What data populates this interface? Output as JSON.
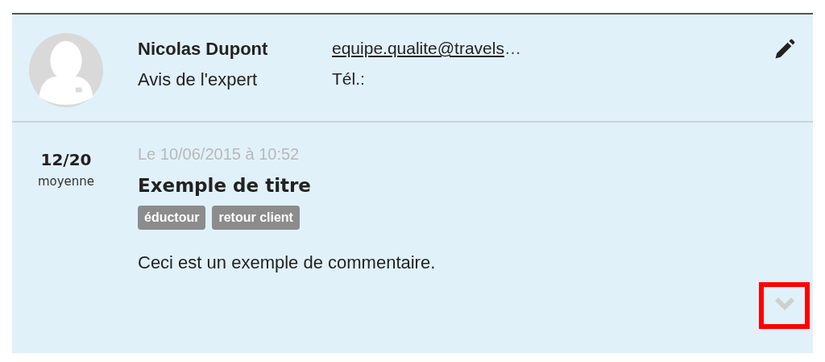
{
  "expert": {
    "name": "Nicolas Dupont",
    "role": "Avis de l'expert",
    "email": "equipe.qualite@travels",
    "email_truncation": "…",
    "phone_label": "Tél.:"
  },
  "review": {
    "score": "12/20",
    "score_label": "moyenne",
    "date": "Le 10/06/2015 à 10:52",
    "title": "Exemple de titre",
    "tags": [
      "éductour",
      "retour client"
    ],
    "comment": "Ceci est un exemple de commentaire.",
    "expand_highlighted": true
  }
}
